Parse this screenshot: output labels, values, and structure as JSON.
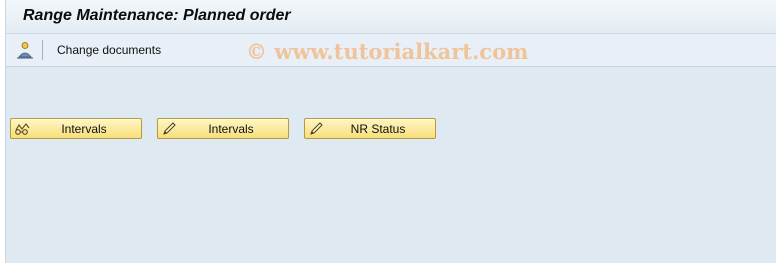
{
  "window": {
    "title": "Range Maintenance: Planned order"
  },
  "toolbar": {
    "icon": "change-documents-icon",
    "change_documents_label": "Change documents"
  },
  "watermark": "© www.tutorialkart.com",
  "buttons": [
    {
      "label": "Intervals",
      "icon": "display-glasses-icon"
    },
    {
      "label": "Intervals",
      "icon": "pencil-icon"
    },
    {
      "label": "NR Status",
      "icon": "pencil-icon"
    }
  ],
  "colors": {
    "background": "#dfe9f2",
    "button_fill": "#f6df7c",
    "button_border": "#b89a3a",
    "watermark": "#f0c39a"
  }
}
